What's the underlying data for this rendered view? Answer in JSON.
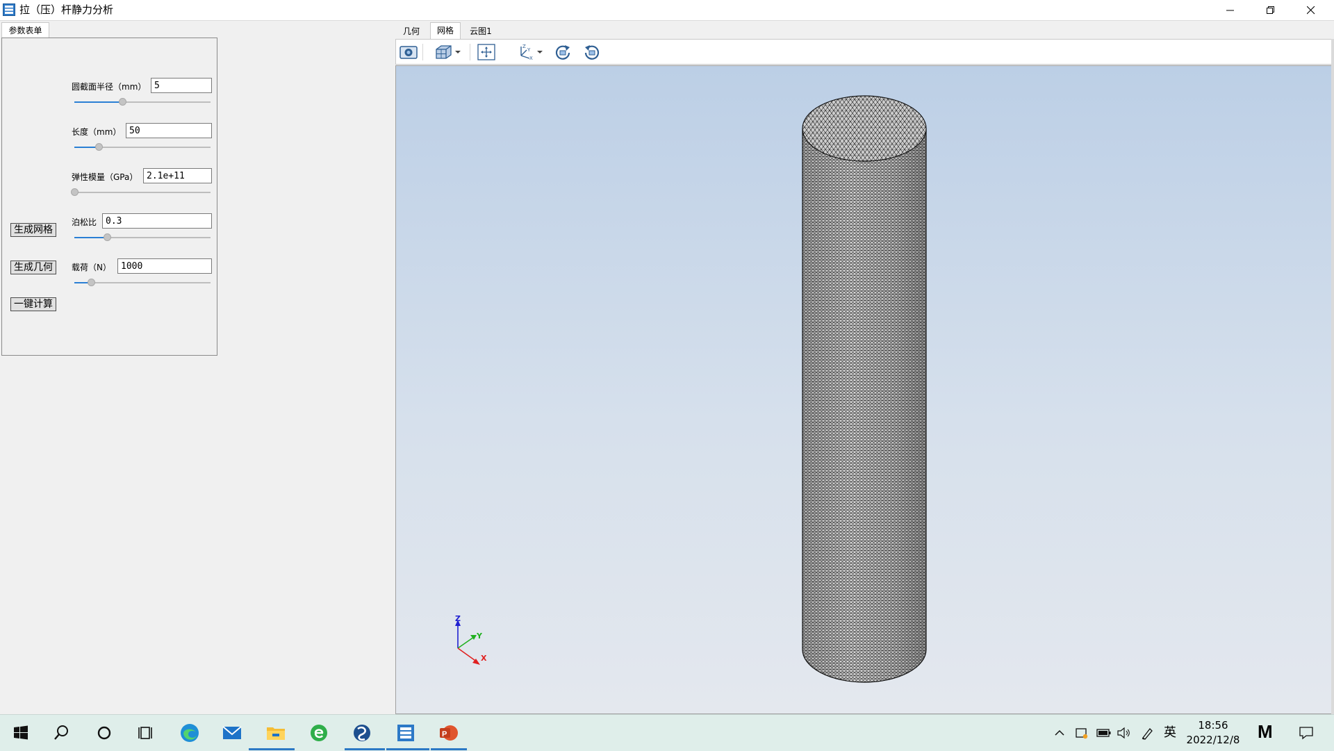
{
  "window": {
    "title": "拉（压）杆静力分析"
  },
  "left_panel": {
    "tab_label": "参数表单",
    "params": [
      {
        "label": "圆截面半径（mm）",
        "value": "5",
        "slider_fraction": 0.35
      },
      {
        "label": "长度（mm）",
        "value": "50",
        "slider_fraction": 0.18
      },
      {
        "label": "弹性模量（GPa）",
        "value": "2.1e+11",
        "slider_fraction": 0.0
      },
      {
        "label": "泊松比",
        "value": "0.3",
        "slider_fraction": 0.24
      },
      {
        "label": "载荷（N）",
        "value": "1000",
        "slider_fraction": 0.12
      }
    ],
    "buttons": {
      "generate_mesh": "生成网格",
      "generate_geometry": "生成几何",
      "one_click_compute": "一键计算"
    }
  },
  "view": {
    "tabs": [
      "几何",
      "网格",
      "云图1"
    ],
    "active_tab": "网格",
    "toolbar_icons": [
      "camera-icon",
      "view-cube-icon",
      "dropdown-arrow-icon",
      "fit-view-icon",
      "axes-icon",
      "dropdown-arrow-icon",
      "rotate-cw-icon",
      "rotate-ccw-icon"
    ],
    "axis_labels": {
      "z": "Z",
      "y": "Y",
      "x": "X"
    },
    "colors": {
      "accent": "#2a7fd4",
      "axis_x": "#e02020",
      "axis_y": "#20b020",
      "axis_z": "#2020d0",
      "mesh_fill": "#c7c7c7",
      "mesh_line": "#1a1a1a"
    }
  },
  "taskbar": {
    "icons": [
      "windows-start-icon",
      "search-icon",
      "cortana-icon",
      "task-view-icon",
      "edge-icon",
      "mail-icon",
      "file-explorer-icon",
      "ie-icon",
      "app-swirl-icon",
      "app-mesh-icon",
      "powerpoint-icon"
    ],
    "ime": "英",
    "time": "18:56",
    "date": "2022/12/8",
    "logo_text": "M"
  }
}
